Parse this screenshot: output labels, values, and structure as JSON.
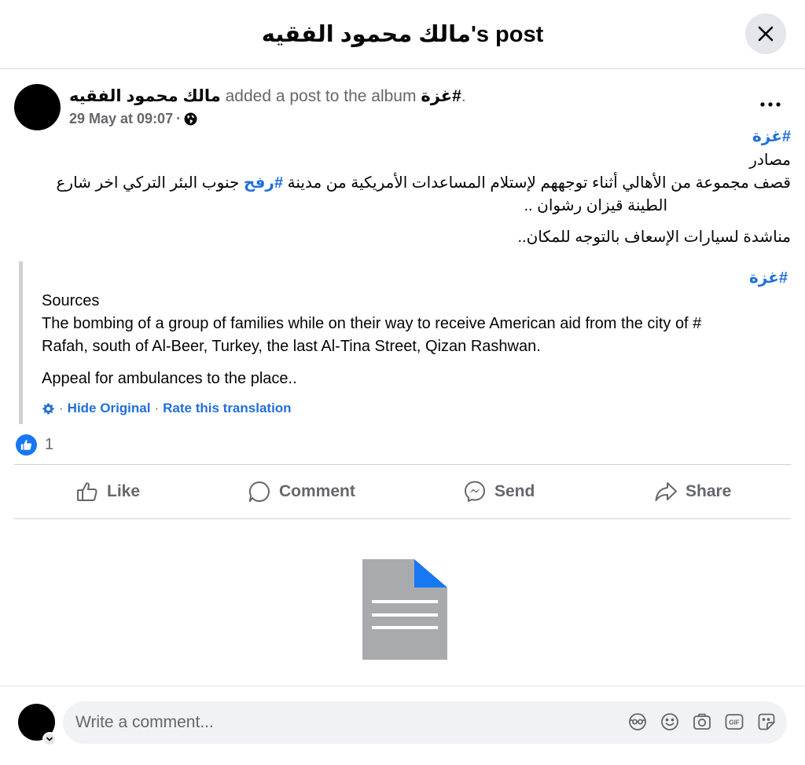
{
  "header": {
    "title": "مالك محمود الفقيه's post"
  },
  "post": {
    "author": "مالك محمود الفقيه",
    "action_text": "added a post to the album",
    "album": "#غزة",
    "album_end": ".",
    "timestamp": "29 May at 09:07",
    "dot": "·",
    "original": {
      "hashtag1": "#غزة",
      "line_sources": "مصادر",
      "line1_pre": "قصف مجموعة من الأهالي أثناء توجههم لإستلام المساعدات الأمريكية من مدينة ",
      "line1_tag": "#رفح",
      "line1_post": " جنوب البئر التركي اخر شارع",
      "line2": "الطينة قيزان رشوان ..",
      "line3": "مناشدة لسيارات الإسعاف بالتوجه للمكان.."
    },
    "translation": {
      "hashtag": "#غزة",
      "line_sources": "Sources",
      "line1": "The bombing of a group of families while on their way to receive American aid from the city of #",
      "line2": "Rafah, south of Al-Beer, Turkey, the last Al-Tina Street, Qizan Rashwan.",
      "line3": "Appeal for ambulances to the place..",
      "links": {
        "sep": "·",
        "hide": "Hide Original",
        "rate": "Rate this translation"
      }
    },
    "reactions": {
      "count": "1"
    }
  },
  "actions": {
    "like": "Like",
    "comment": "Comment",
    "send": "Send",
    "share": "Share"
  },
  "comment_box": {
    "placeholder": "Write a comment..."
  },
  "colors": {
    "link": "#216fdb",
    "muted": "#65676b",
    "like_blue": "#1877f2"
  },
  "icons": [
    "close-icon",
    "more-icon",
    "globe-icon",
    "settings-icon",
    "like-reaction-icon",
    "like-icon",
    "comment-icon",
    "messenger-icon",
    "share-icon",
    "document-icon",
    "avatar-icon",
    "emoji-icon",
    "camera-icon",
    "gif-icon",
    "sticker-icon"
  ]
}
